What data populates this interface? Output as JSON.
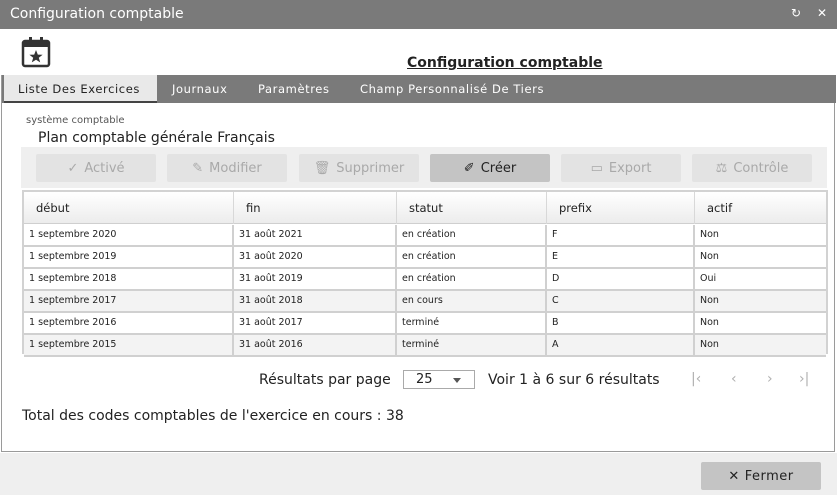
{
  "window": {
    "title": "Configuration comptable",
    "refresh_icon": "↻",
    "close_icon": "✕"
  },
  "header": {
    "app_icon": "calendar-star-icon",
    "title": "Configuration comptable"
  },
  "tabs": [
    {
      "label": "Liste Des Exercices",
      "active": true
    },
    {
      "label": "Journaux",
      "active": false
    },
    {
      "label": "Paramètres",
      "active": false
    },
    {
      "label": "Champ Personnalisé De Tiers",
      "active": false
    }
  ],
  "system": {
    "label": "système comptable",
    "value": "Plan comptable générale Français"
  },
  "toolbar": {
    "buttons": [
      {
        "label": "Activé",
        "icon": "✓",
        "enabled": false
      },
      {
        "label": "Modifier",
        "icon": "✎",
        "enabled": false
      },
      {
        "label": "Supprimer",
        "icon": "🗑",
        "enabled": false
      },
      {
        "label": "Créer",
        "icon": "✐",
        "enabled": true
      },
      {
        "label": "Export",
        "icon": "▭",
        "enabled": false
      },
      {
        "label": "Contrôle",
        "icon": "⚖",
        "enabled": false
      }
    ]
  },
  "table": {
    "columns": [
      "début",
      "fin",
      "statut",
      "prefix",
      "actif"
    ],
    "rows": [
      [
        "1 septembre 2020",
        "31 août 2021",
        "en création",
        "F",
        "Non"
      ],
      [
        "1 septembre 2019",
        "31 août 2020",
        "en création",
        "E",
        "Non"
      ],
      [
        "1 septembre 2018",
        "31 août 2019",
        "en création",
        "D",
        "Oui"
      ],
      [
        "1 septembre 2017",
        "31 août 2018",
        "en cours",
        "C",
        "Non"
      ],
      [
        "1 septembre 2016",
        "31 août 2017",
        "terminé",
        "B",
        "Non"
      ],
      [
        "1 septembre 2015",
        "31 août 2016",
        "terminé",
        "A",
        "Non"
      ]
    ]
  },
  "pager": {
    "label": "Résultats par page",
    "page_size": "25",
    "info": "Voir 1 à 6 sur 6 résultats",
    "first_icon": "|‹",
    "prev_icon": "‹",
    "next_icon": "›",
    "last_icon": "›|"
  },
  "summary": {
    "total_text": "Total des codes comptables de l'exercice en cours : 38"
  },
  "footer": {
    "close_label": "Fermer",
    "close_icon": "✕"
  }
}
